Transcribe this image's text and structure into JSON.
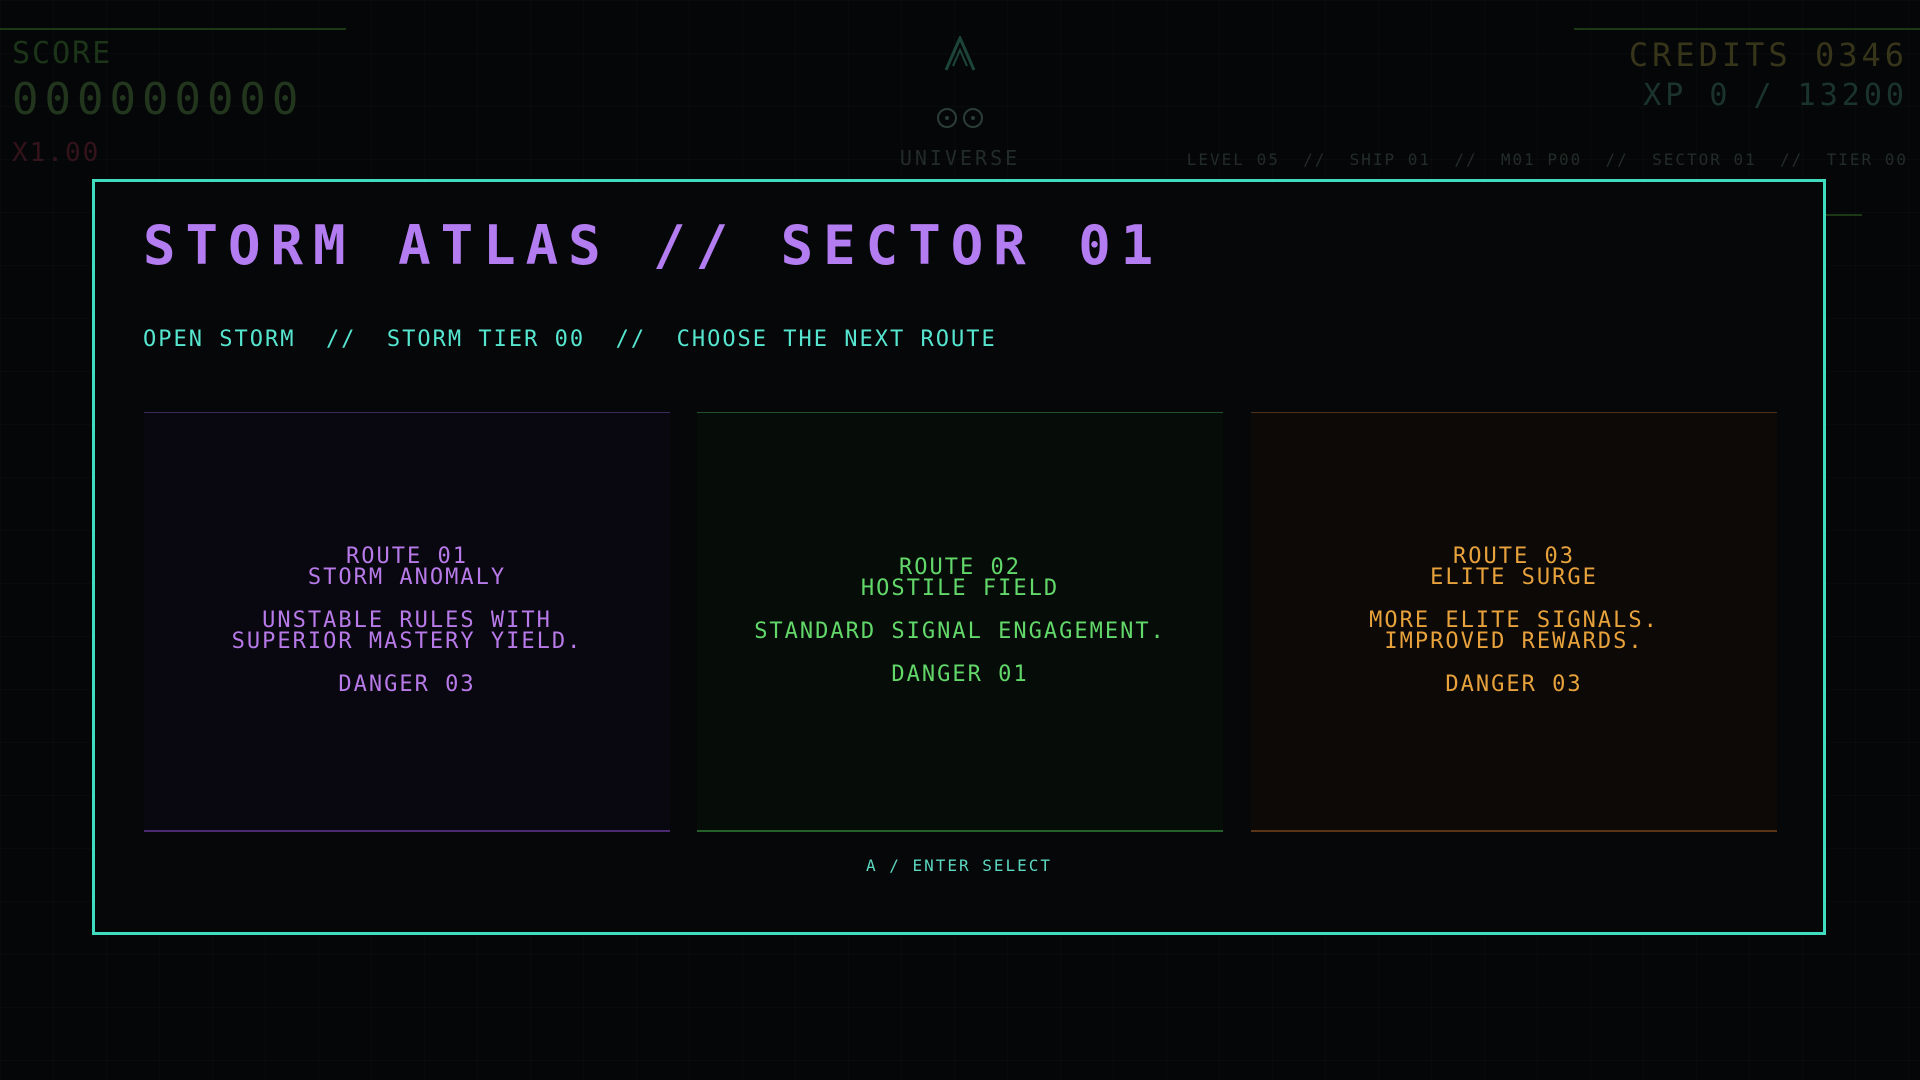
{
  "hud": {
    "score_label": "SCORE",
    "score_value": "000000000",
    "multiplier": "X1.00",
    "credits": "CREDITS 0346",
    "xp": "XP 0 / 13200",
    "status_line": "LEVEL 05  //  SHIP 01  //  M01 P00  //  SECTOR 01  //  TIER 00",
    "universe_label": "UNIVERSE",
    "ship_icon": "ship-triangle-icon",
    "orbit_icon": "double-orbit-icon"
  },
  "modal": {
    "title": "STORM ATLAS // SECTOR 01",
    "subtitle": "OPEN STORM  //  STORM TIER 00  //  CHOOSE THE NEXT ROUTE",
    "routes": [
      {
        "line1": "ROUTE 01",
        "line2": "STORM ANOMALY",
        "desc": "UNSTABLE RULES WITH SUPERIOR MASTERY YIELD.",
        "danger": "DANGER 03",
        "color": "#b77ae8"
      },
      {
        "line1": "ROUTE 02",
        "line2": "HOSTILE FIELD",
        "desc": "STANDARD SIGNAL ENGAGEMENT.",
        "danger": "DANGER 01",
        "color": "#63d86a"
      },
      {
        "line1": "ROUTE 03",
        "line2": "ELITE SURGE",
        "desc": "MORE ELITE SIGNALS. IMPROVED REWARDS.",
        "danger": "DANGER 03",
        "color": "#e8a23c"
      }
    ],
    "select_hint": "A / ENTER SELECT"
  },
  "colors": {
    "frame": "#3fdcc0",
    "title": "#b37cf0",
    "subtitle": "#56e6d0",
    "background": "#050608"
  }
}
